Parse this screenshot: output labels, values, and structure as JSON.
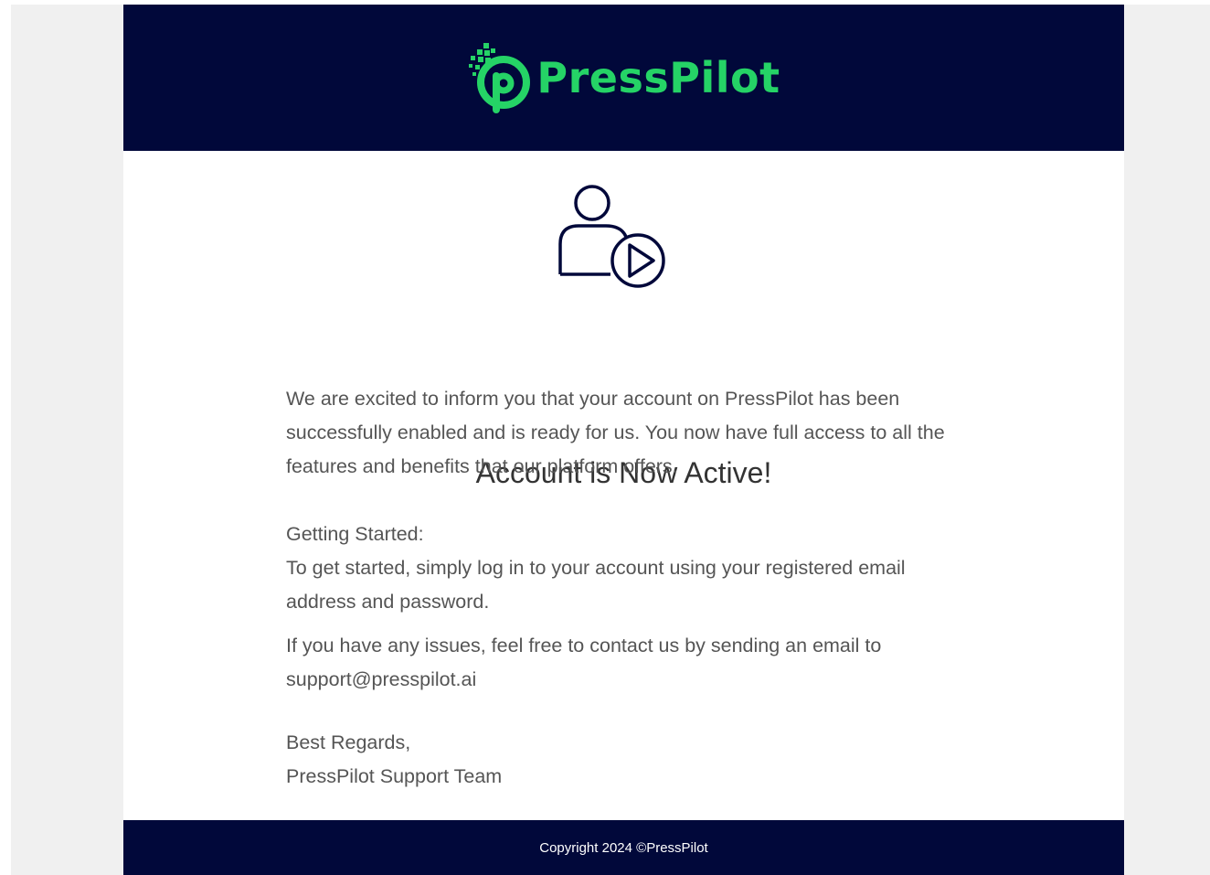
{
  "brand": {
    "name": "PressPilot",
    "accent_color": "#25d366",
    "dark_color": "#01083a",
    "logo_icon": "presspilot-p-logo-icon"
  },
  "hero": {
    "icon": "user-play-icon",
    "heading": "Account is Now Active!"
  },
  "message": {
    "intro": "We are excited to inform you that your account on PressPilot has been successfully enabled and is ready for us. You now have full access to all the features and benefits that our platform offers.",
    "getting_started_title": "Getting Started:",
    "getting_started_text": "To get started, simply log in to your account using your registered email address and password.",
    "support_text": "If you have any issues, feel free to contact us by sending an email to support@presspilot.ai",
    "signoff": "Best Regards,",
    "team": "PressPilot Support Team"
  },
  "footer": {
    "copyright": "Copyright 2024 ©PressPilot"
  }
}
